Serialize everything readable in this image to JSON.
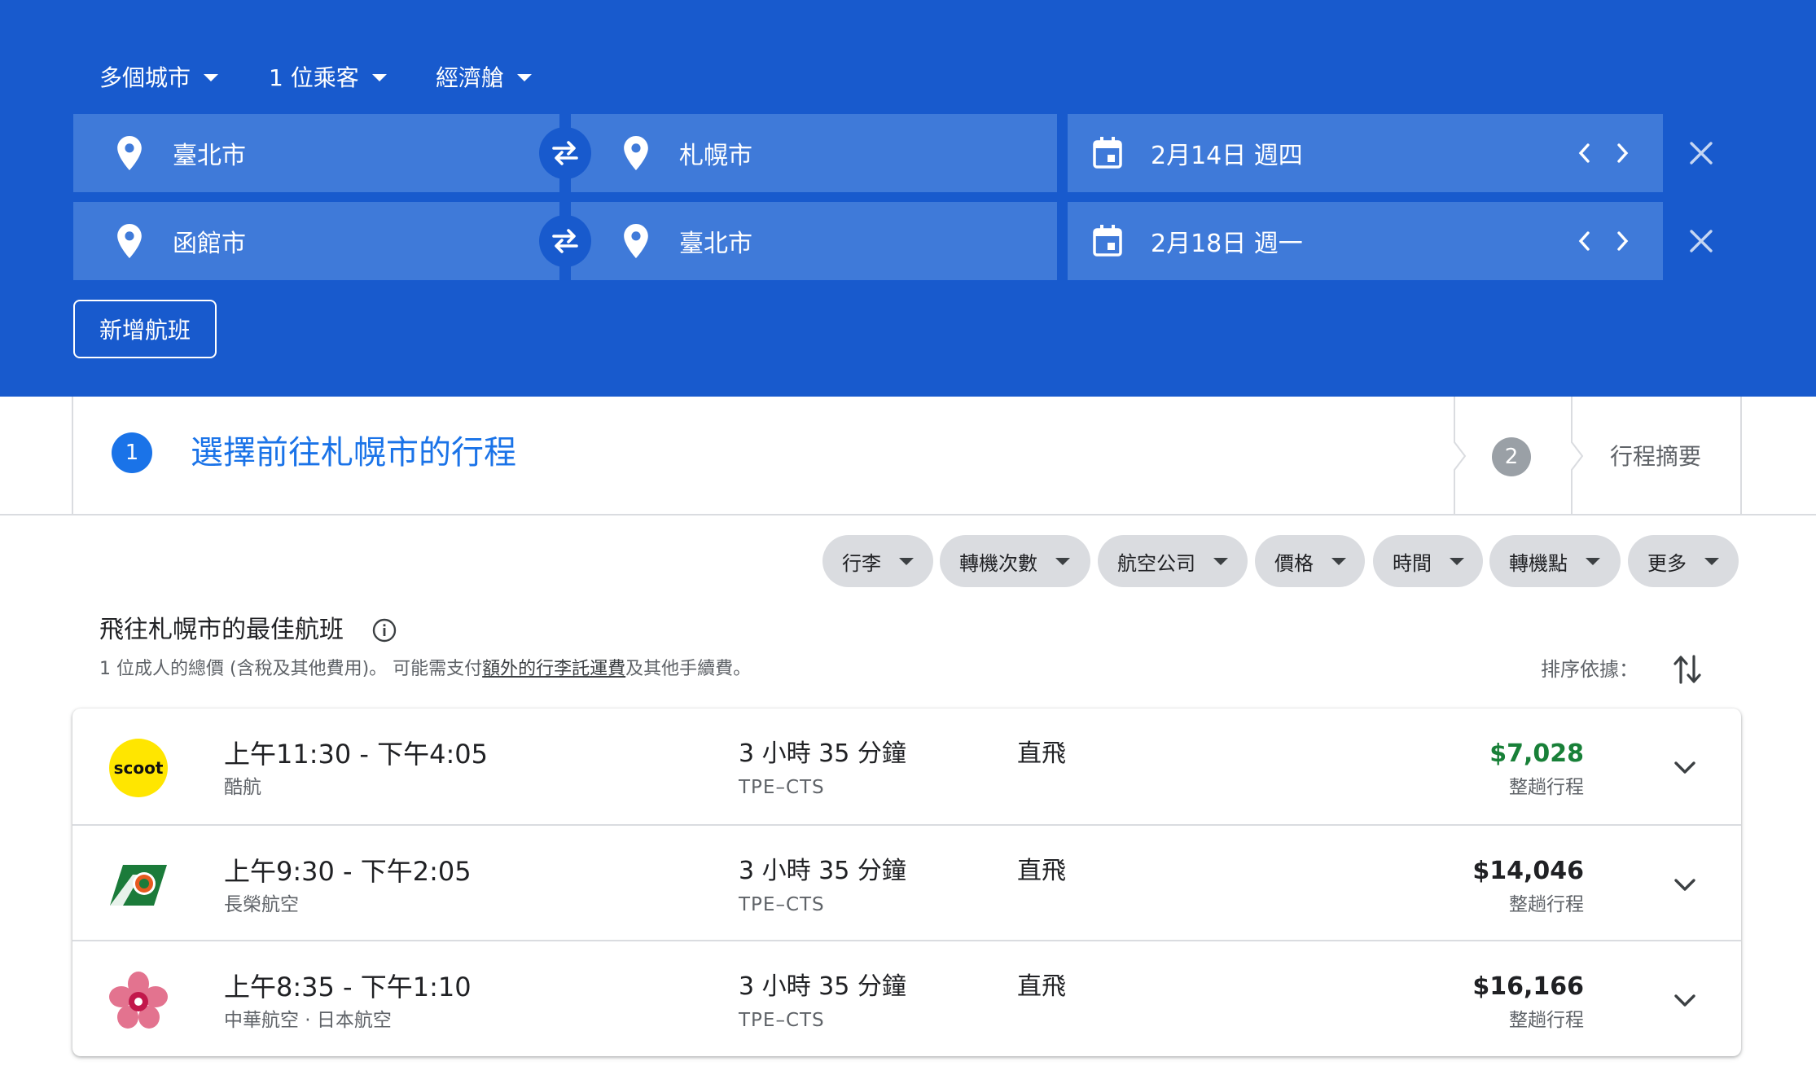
{
  "search": {
    "trip_type": "多個城市",
    "passengers": "1 位乘客",
    "cabin": "經濟艙",
    "legs": [
      {
        "origin": "臺北市",
        "destination": "札幌市",
        "date": "2月14日 週四"
      },
      {
        "origin": "函館市",
        "destination": "臺北市",
        "date": "2月18日 週一"
      }
    ],
    "add_flight_label": "新增航班"
  },
  "steps": {
    "step1_number": "1",
    "step1_label": "選擇前往札幌市的行程",
    "step2_number": "2",
    "step3_label": "行程摘要"
  },
  "filters": [
    "行李",
    "轉機次數",
    "航空公司",
    "價格",
    "時間",
    "轉機點",
    "更多"
  ],
  "section": {
    "title": "飛往札幌市的最佳航班",
    "subtitle_before": "1 位成人的總價 (含稅及其他費用)。 可能需支付",
    "subtitle_link": "額外的行李託運費",
    "subtitle_after": "及其他手續費。",
    "sort_label": "排序依據："
  },
  "flights": [
    {
      "times": "上午11:30 - 下午4:05",
      "airline": "酷航",
      "duration": "3 小時 35 分鐘",
      "route": "TPE–CTS",
      "stops": "直飛",
      "price": "$7,028",
      "price_type": "整趟行程",
      "logo": "scoot-logo",
      "logo_text": "scoot"
    },
    {
      "times": "上午9:30 - 下午2:05",
      "airline": "長榮航空",
      "duration": "3 小時 35 分鐘",
      "route": "TPE–CTS",
      "stops": "直飛",
      "price": "$14,046",
      "price_type": "整趟行程",
      "logo": "eva-air-logo"
    },
    {
      "times": "上午8:35 - 下午1:10",
      "airline": "中華航空 · 日本航空",
      "duration": "3 小時 35 分鐘",
      "route": "TPE–CTS",
      "stops": "直飛",
      "price": "$16,166",
      "price_type": "整趟行程",
      "logo": "china-airlines-logo"
    }
  ],
  "colors": {
    "header_blue": "#185acd",
    "field_blue": "#3f7ad9",
    "accent_blue": "#1a73e8",
    "price_green": "#188038"
  }
}
